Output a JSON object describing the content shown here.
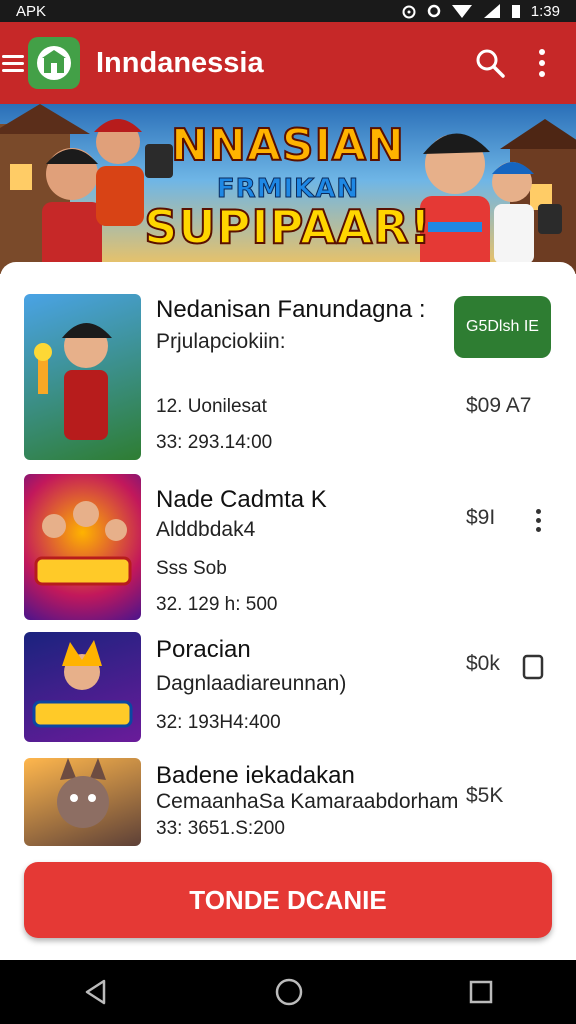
{
  "status_bar": {
    "left_text": "APK",
    "time": "1:39",
    "icons": [
      "alarm-icon",
      "circle-icon",
      "wifi-icon",
      "signal-icon",
      "battery-icon"
    ]
  },
  "app_bar": {
    "title": "Inndanessia",
    "logo_icon": "shop-icon",
    "search_icon": "search-icon",
    "more_icon": "more-vert-icon"
  },
  "banner": {
    "line1": "NNASIAN",
    "line2": "FRMIKAN",
    "line3": "SUPIPAAR!"
  },
  "items": [
    {
      "title": "Nedanisan Fanundagna :",
      "subtitle": "Prjulapciokiin:",
      "meta1": "12. Uonilesat",
      "meta2": "33: 293.14:00",
      "action_label": "G5Dlsh IE",
      "price": "$09 A7"
    },
    {
      "title": "Nade Cadmta K",
      "subtitle": "Alddbdak4",
      "meta1": "Sss Sob",
      "meta2": "32. 129 h: 500",
      "price": "$9I"
    },
    {
      "title": "Poracian",
      "subtitle": "Dagnlaadiareunnan)",
      "meta2": "32: 193H4:400",
      "price": "$0k"
    },
    {
      "title": "Badene iekadakan",
      "subtitle": "CemaanhaSa Kamaraabdorham",
      "meta2": "33: 3651.S:200",
      "price": "$5K"
    }
  ],
  "cta": {
    "label": "TONDE DCANIE"
  },
  "nav": {
    "back_icon": "back-icon",
    "home_icon": "home-icon",
    "recents_icon": "recents-icon"
  },
  "colors": {
    "app_bar": "#c62828",
    "logo_green": "#43a047",
    "button_green": "#2e7d32",
    "cta_red": "#e53935"
  }
}
